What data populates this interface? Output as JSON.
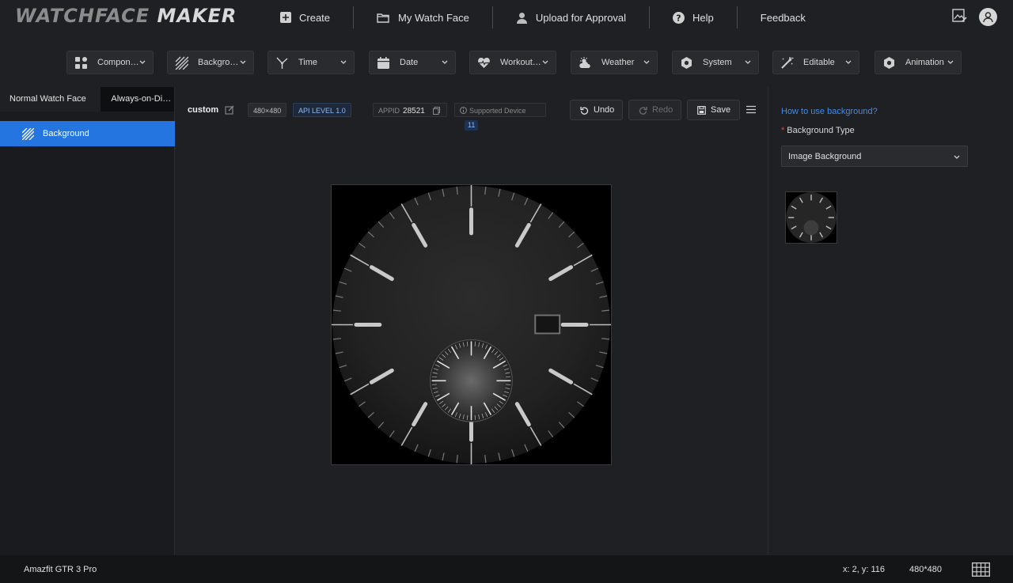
{
  "app": {
    "logo_left": "WATCHFACE ",
    "logo_right": "MAKER"
  },
  "nav": {
    "create": "Create",
    "my_watch_face": "My Watch Face",
    "upload": "Upload for Approval",
    "help": "Help",
    "feedback": "Feedback"
  },
  "toolbar": {
    "components": "Components",
    "background": "Background",
    "time": "Time",
    "date": "Date",
    "workout": "Workout Data",
    "weather": "Weather",
    "system": "System",
    "editable": "Editable",
    "animation": "Animation"
  },
  "left": {
    "tab_normal": "Normal Watch Face",
    "tab_aod": "Always-on-Display",
    "layer_background": "Background"
  },
  "editor": {
    "title": "custom",
    "resolution": "480×480",
    "api_level": "API LEVEL  1.0",
    "appid_label": "APPID",
    "appid_value": "28521",
    "supported_device_label": "Supported Device",
    "supported_device_count": "11",
    "undo": "Undo",
    "redo": "Redo",
    "save": "Save"
  },
  "right": {
    "help_link": "How to use background?",
    "background_type_label": "Background Type",
    "background_type_value": "Image Background"
  },
  "status": {
    "device": "Amazfit GTR 3 Pro",
    "coords": "x: 2, y: 116",
    "size": "480*480"
  },
  "colors": {
    "accent": "#2575e0",
    "link": "#3f8cf0",
    "required": "#e8483f"
  }
}
